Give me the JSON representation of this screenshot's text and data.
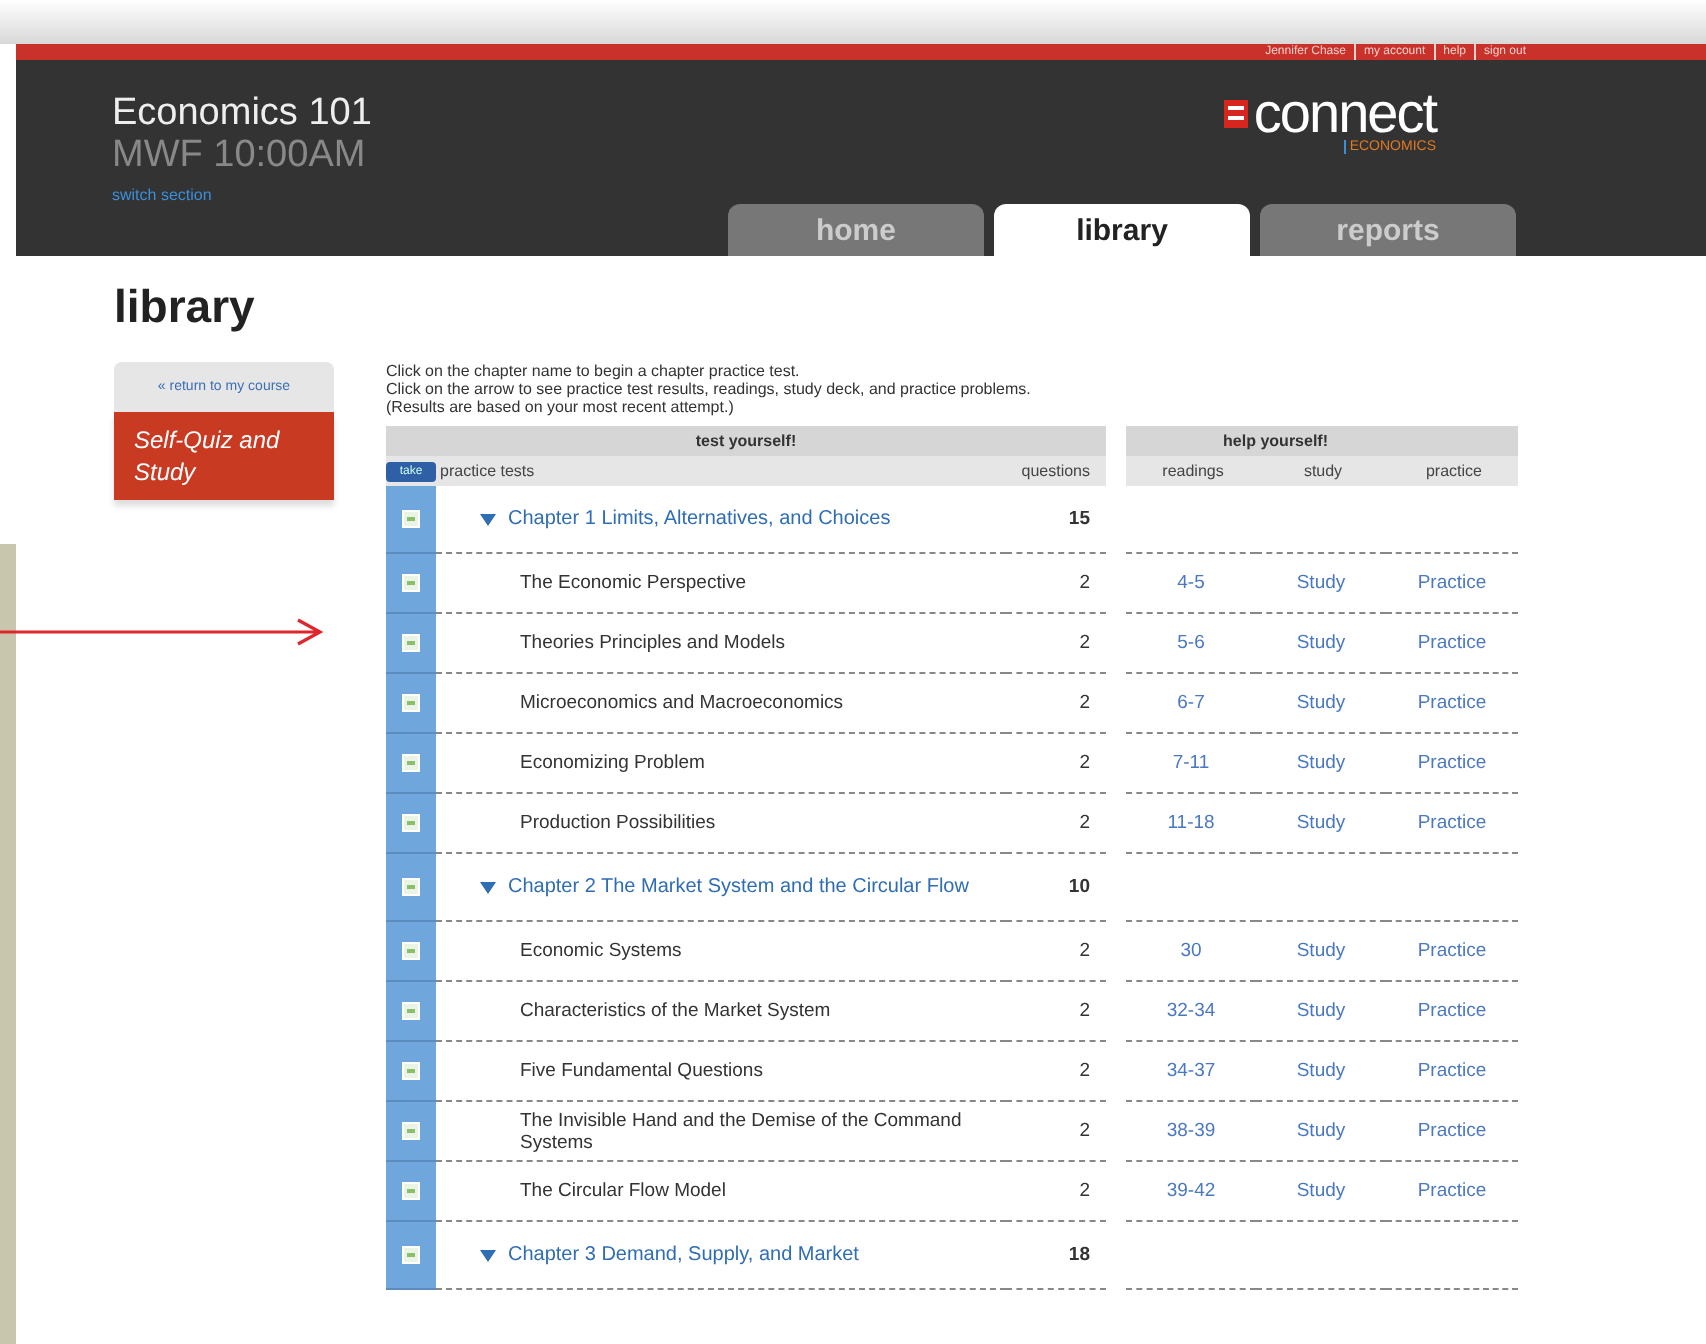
{
  "top_links": [
    "Jennifer Chase",
    "my account",
    "help",
    "sign out"
  ],
  "course": {
    "title": "Economics 101",
    "schedule": "MWF 10:00AM",
    "switch_link": "switch section"
  },
  "logo": {
    "name": "connect",
    "subject": "ECONOMICS"
  },
  "tabs": [
    {
      "label": "home",
      "selected": false
    },
    {
      "label": "library",
      "selected": true
    },
    {
      "label": "reports",
      "selected": false
    }
  ],
  "page_title": "library",
  "sidebar": {
    "return_link": "« return to my course",
    "items": [
      {
        "label": "Self-Quiz and Study",
        "selected": true
      }
    ]
  },
  "instructions": [
    "Click on the chapter name to begin a chapter practice test.",
    "Click on the arrow to see practice test results, readings, study deck, and practice problems.",
    "(Results are based on your most recent attempt.)"
  ],
  "table": {
    "group_left": "test yourself!",
    "group_right": "help yourself!",
    "take_button": "take",
    "columns": [
      "practice tests",
      "questions",
      "readings",
      "study",
      "practice"
    ],
    "rows": [
      {
        "kind": "chapter",
        "name": "Chapter 1 Limits, Alternatives, and Choices",
        "questions": "15",
        "expanded": true
      },
      {
        "kind": "section",
        "name": "The Economic Perspective",
        "questions": "2",
        "readings": "4-5",
        "study": "Study",
        "practice": "Practice"
      },
      {
        "kind": "section",
        "name": "Theories Principles and Models",
        "questions": "2",
        "readings": "5-6",
        "study": "Study",
        "practice": "Practice"
      },
      {
        "kind": "section",
        "name": "Microeconomics and Macroeconomics",
        "questions": "2",
        "readings": "6-7",
        "study": "Study",
        "practice": "Practice"
      },
      {
        "kind": "section",
        "name": "Economizing Problem",
        "questions": "2",
        "readings": "7-11",
        "study": "Study",
        "practice": "Practice"
      },
      {
        "kind": "section",
        "name": "Production Possibilities",
        "questions": "2",
        "readings": "11-18",
        "study": "Study",
        "practice": "Practice"
      },
      {
        "kind": "chapter",
        "name": "Chapter 2 The Market System and the Circular Flow",
        "questions": "10",
        "expanded": true
      },
      {
        "kind": "section",
        "name": "Economic Systems",
        "questions": "2",
        "readings": "30",
        "study": "Study",
        "practice": "Practice"
      },
      {
        "kind": "section",
        "name": "Characteristics of the Market System",
        "questions": "2",
        "readings": "32-34",
        "study": "Study",
        "practice": "Practice"
      },
      {
        "kind": "section",
        "name": "Five Fundamental Questions",
        "questions": "2",
        "readings": "34-37",
        "study": "Study",
        "practice": "Practice"
      },
      {
        "kind": "section",
        "name": "The Invisible Hand and the Demise of the Command Systems",
        "questions": "2",
        "readings": "38-39",
        "study": "Study",
        "practice": "Practice"
      },
      {
        "kind": "section",
        "name": "The Circular Flow Model",
        "questions": "2",
        "readings": "39-42",
        "study": "Study",
        "practice": "Practice"
      },
      {
        "kind": "chapter",
        "name": "Chapter 3 Demand, Supply, and Market",
        "questions": "18",
        "expanded": true
      }
    ]
  }
}
